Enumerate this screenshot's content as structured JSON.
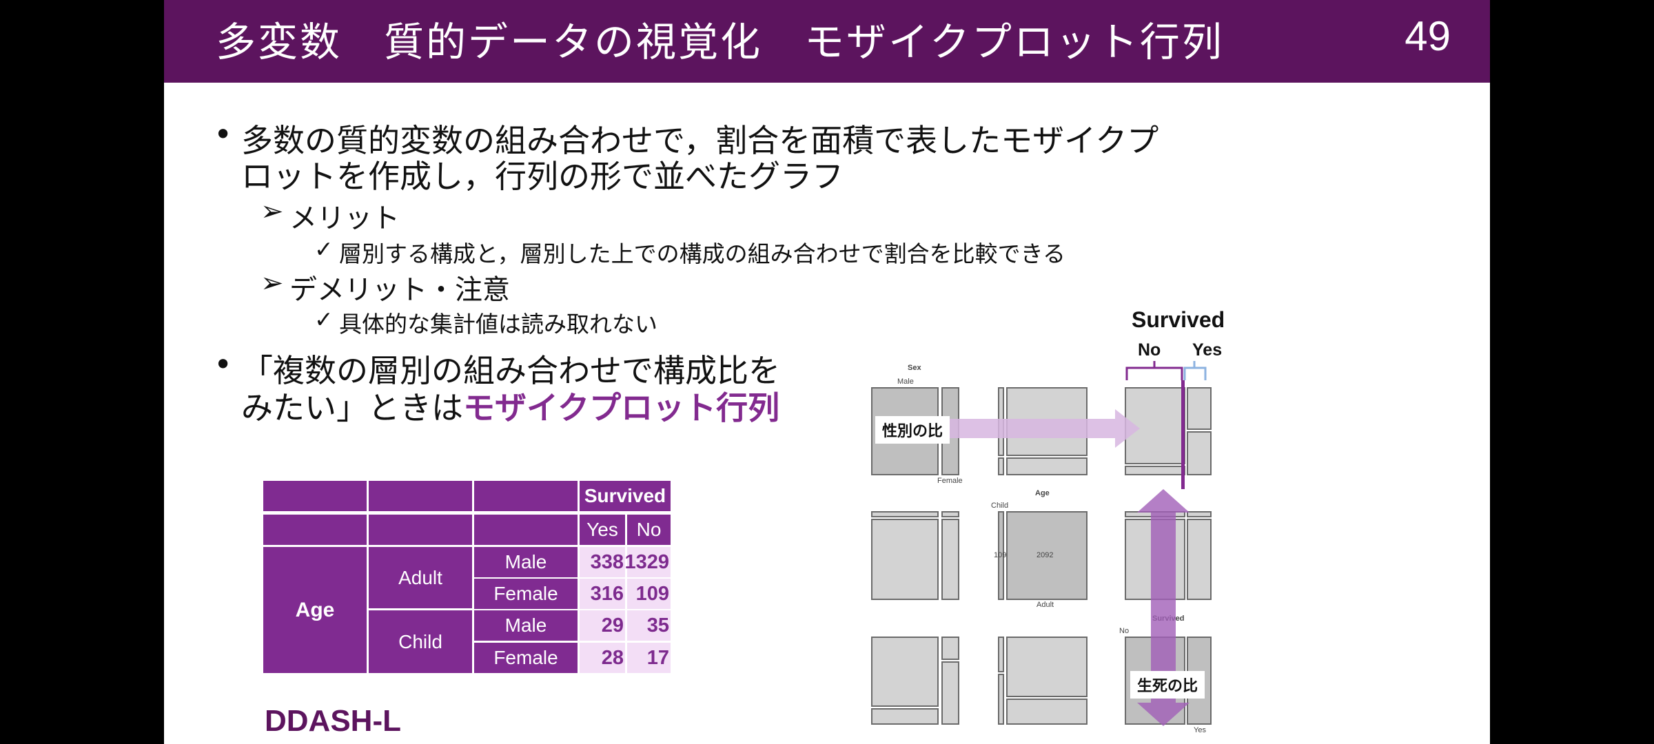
{
  "header": {
    "title": "多変数　質的データの視覚化　モザイクプロット行列",
    "page_number": "49"
  },
  "content": {
    "bullet1_line1": "多数の質的変数の組み合わせで，割合を面積で表したモザイクプ",
    "bullet1_line2": "ロットを作成し，行列の形で並べたグラフ",
    "merit_label": "メリット",
    "merit_item": "層別する構成と，層別した上での構成の組み合わせで割合を比較できる",
    "demerit_label": "デメリット・注意",
    "demerit_item": "具体的な集計値は読み取れない",
    "bullet2_line1": "「複数の層別の組み合わせで構成比を",
    "bullet2_line2_prefix": "みたい」ときは",
    "bullet2_highlight": "モザイクプロット行列"
  },
  "table": {
    "survived_header": "Survived",
    "yes_header": "Yes",
    "no_header": "No",
    "age_label": "Age",
    "adult_label": "Adult",
    "child_label": "Child",
    "rows": [
      {
        "sex": "Male",
        "yes": "338",
        "no": "1329"
      },
      {
        "sex": "Female",
        "yes": "316",
        "no": "109"
      },
      {
        "sex": "Male",
        "yes": "29",
        "no": "35"
      },
      {
        "sex": "Female",
        "yes": "28",
        "no": "17"
      }
    ]
  },
  "brand": "DDASH-L",
  "mosaic": {
    "survived_title": "Survived",
    "no_label": "No",
    "yes_label": "Yes",
    "sex_label": "Sex",
    "male_label": "Male",
    "female_label": "Female",
    "age_label": "Age",
    "child_label": "Child",
    "adult_label": "Adult",
    "child_count": "109",
    "adult_count": "2092",
    "survived_small": "Survived",
    "no_small": "No",
    "yes_small": "Yes",
    "sex_ratio_tag": "性別の比",
    "survival_ratio_tag": "生死の比"
  },
  "colors": {
    "header": "#5c145e",
    "accent": "#822a8f",
    "table_dark": "#802b91",
    "table_light": "#f3def6"
  }
}
